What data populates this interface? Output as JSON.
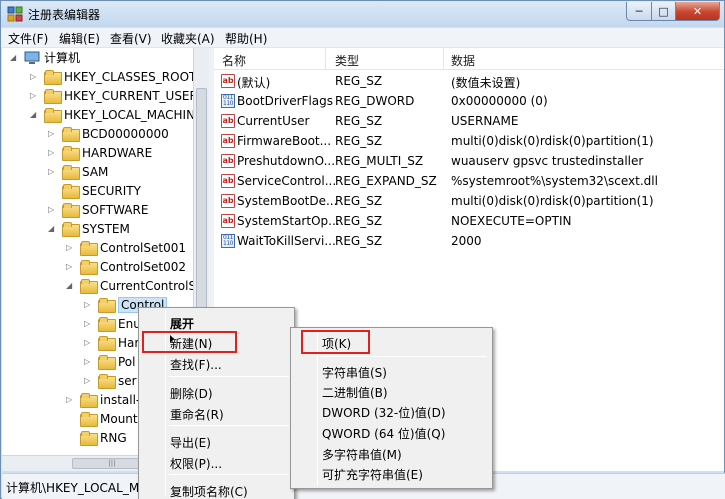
{
  "window": {
    "title": "注册表编辑器",
    "btn_min": "─",
    "btn_max": "□",
    "btn_close": "✕"
  },
  "menu": [
    "文件(F)",
    "编辑(E)",
    "查看(V)",
    "收藏夹(A)",
    "帮助(H)"
  ],
  "tree": {
    "root": "计算机",
    "nodes": [
      {
        "label": "HKEY_CLASSES_ROOT"
      },
      {
        "label": "HKEY_CURRENT_USER"
      },
      {
        "label": "HKEY_LOCAL_MACHINE"
      },
      {
        "label": "BCD00000000"
      },
      {
        "label": "HARDWARE"
      },
      {
        "label": "SAM"
      },
      {
        "label": "SECURITY"
      },
      {
        "label": "SOFTWARE"
      },
      {
        "label": "SYSTEM"
      },
      {
        "label": "ControlSet001"
      },
      {
        "label": "ControlSet002"
      },
      {
        "label": "CurrentControlSe"
      },
      {
        "label": "Control"
      },
      {
        "label": "Enu"
      },
      {
        "label": "Har"
      },
      {
        "label": "Pol"
      },
      {
        "label": "ser"
      },
      {
        "label": "install-"
      },
      {
        "label": "Mount"
      },
      {
        "label": "RNG"
      }
    ]
  },
  "list": {
    "headers": {
      "name": "名称",
      "type": "类型",
      "data": "数据"
    },
    "rows": [
      {
        "icon": "string-value-icon",
        "name": "(默认)",
        "type": "REG_SZ",
        "data": "(数值未设置)"
      },
      {
        "icon": "binary-value-icon",
        "name": "BootDriverFlags",
        "type": "REG_DWORD",
        "data": "0x00000000 (0)"
      },
      {
        "icon": "string-value-icon",
        "name": "CurrentUser",
        "type": "REG_SZ",
        "data": "USERNAME"
      },
      {
        "icon": "string-value-icon",
        "name": "FirmwareBoot...",
        "type": "REG_SZ",
        "data": "multi(0)disk(0)rdisk(0)partition(1)"
      },
      {
        "icon": "string-value-icon",
        "name": "PreshutdownO...",
        "type": "REG_MULTI_SZ",
        "data": "wuauserv gpsvc trustedinstaller"
      },
      {
        "icon": "string-value-icon",
        "name": "ServiceControl...",
        "type": "REG_EXPAND_SZ",
        "data": "%systemroot%\\system32\\scext.dll"
      },
      {
        "icon": "string-value-icon",
        "name": "SystemBootDe...",
        "type": "REG_SZ",
        "data": "multi(0)disk(0)rdisk(0)partition(1)"
      },
      {
        "icon": "string-value-icon",
        "name": "SystemStartOp...",
        "type": "REG_SZ",
        "data": " NOEXECUTE=OPTIN"
      },
      {
        "icon": "binary-value-icon",
        "name": "WaitToKillServi...",
        "type": "REG_SZ",
        "data": "2000"
      }
    ],
    "icon_glyphs": {
      "string": "ab",
      "binary": "011\n110"
    }
  },
  "status": {
    "path": "计算机\\HKEY_LOCAL_MA"
  },
  "tree_scroll_glyph": "|||",
  "context_menu": {
    "items": [
      {
        "label": "展开"
      },
      {
        "label": "新建(N)"
      },
      {
        "label": "查找(F)..."
      },
      {
        "label": "删除(D)"
      },
      {
        "label": "重命名(R)"
      },
      {
        "label": "导出(E)"
      },
      {
        "label": "权限(P)..."
      },
      {
        "label": "复制项名称(C)"
      }
    ]
  },
  "submenu": {
    "items": [
      {
        "label": "项(K)"
      },
      {
        "label": "字符串值(S)"
      },
      {
        "label": "二进制值(B)"
      },
      {
        "label": "DWORD (32-位)值(D)"
      },
      {
        "label": "QWORD (64 位)值(Q)"
      },
      {
        "label": "多字符串值(M)"
      },
      {
        "label": "可扩充字符串值(E)"
      }
    ]
  },
  "colors": {
    "highlight": "#e02020",
    "selection": "#cce4f7"
  }
}
